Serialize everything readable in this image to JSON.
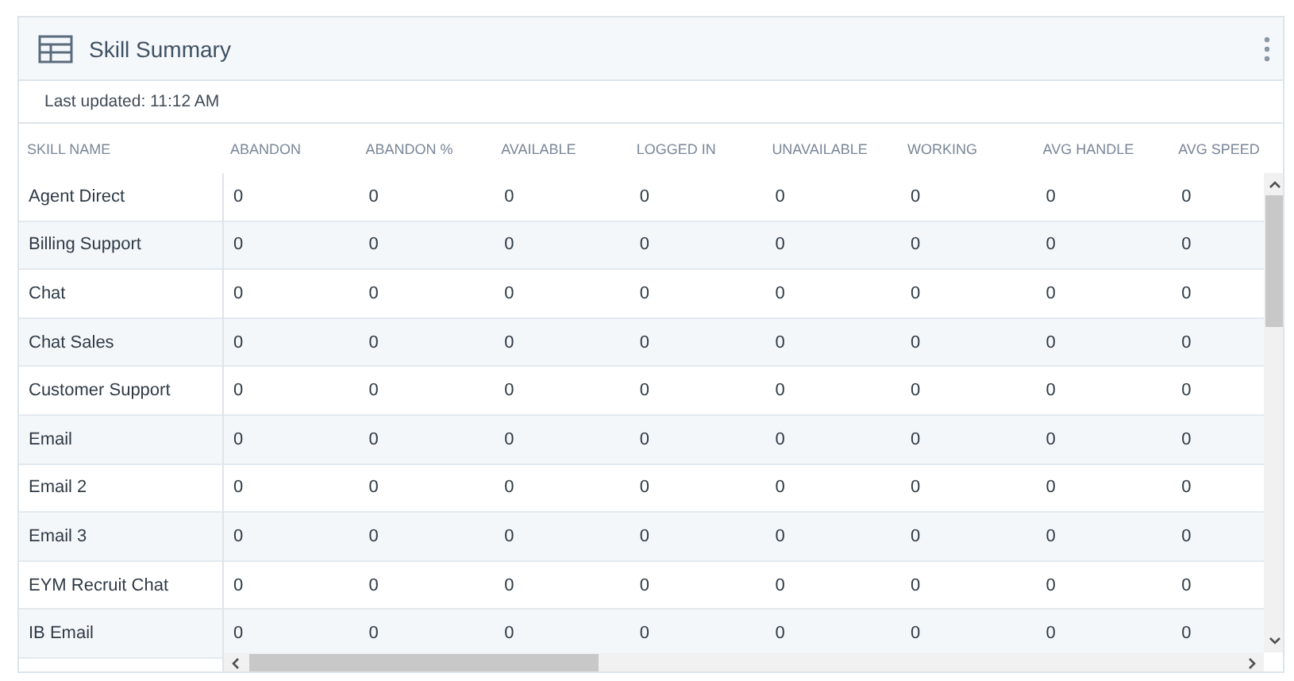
{
  "card": {
    "title": "Skill Summary",
    "last_updated": "Last updated: 11:12 AM"
  },
  "table": {
    "columns": [
      "SKILL NAME",
      "ABANDON",
      "ABANDON %",
      "AVAILABLE",
      "LOGGED IN",
      "UNAVAILABLE",
      "WORKING",
      "AVG HANDLE",
      "AVG SPEED"
    ],
    "rows": [
      {
        "name": "Agent Direct",
        "values": [
          "0",
          "0",
          "0",
          "0",
          "0",
          "0",
          "0",
          "0"
        ]
      },
      {
        "name": "Billing Support",
        "values": [
          "0",
          "0",
          "0",
          "0",
          "0",
          "0",
          "0",
          "0"
        ]
      },
      {
        "name": "Chat",
        "values": [
          "0",
          "0",
          "0",
          "0",
          "0",
          "0",
          "0",
          "0"
        ]
      },
      {
        "name": "Chat Sales",
        "values": [
          "0",
          "0",
          "0",
          "0",
          "0",
          "0",
          "0",
          "0"
        ]
      },
      {
        "name": "Customer Support",
        "values": [
          "0",
          "0",
          "0",
          "0",
          "0",
          "0",
          "0",
          "0"
        ]
      },
      {
        "name": "Email",
        "values": [
          "0",
          "0",
          "0",
          "0",
          "0",
          "0",
          "0",
          "0"
        ]
      },
      {
        "name": "Email 2",
        "values": [
          "0",
          "0",
          "0",
          "0",
          "0",
          "0",
          "0",
          "0"
        ]
      },
      {
        "name": "Email 3",
        "values": [
          "0",
          "0",
          "0",
          "0",
          "0",
          "0",
          "0",
          "0"
        ]
      },
      {
        "name": "EYM Recruit Chat",
        "values": [
          "0",
          "0",
          "0",
          "0",
          "0",
          "0",
          "0",
          "0"
        ]
      },
      {
        "name": "IB Email",
        "values": [
          "0",
          "0",
          "0",
          "0",
          "0",
          "0",
          "0",
          "0"
        ]
      }
    ]
  }
}
